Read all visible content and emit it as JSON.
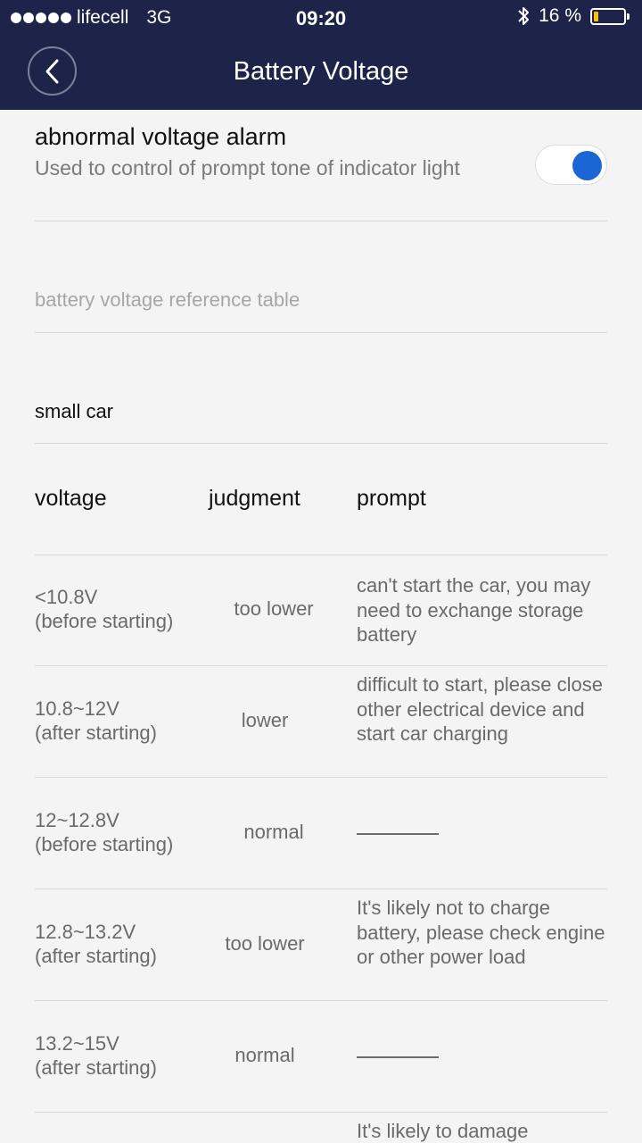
{
  "status_bar": {
    "carrier": "lifecell",
    "network": "3G",
    "time": "09:20",
    "battery": "16 %",
    "battery_level": 0.16
  },
  "nav": {
    "title": "Battery Voltage",
    "back_icon": "chevron-left-icon"
  },
  "alarm": {
    "title": "abnormal voltage alarm",
    "description": "Used to control of prompt tone of  indicator light",
    "toggle_on": true,
    "toggle_color": "#1a66d4"
  },
  "reference_title": "battery voltage reference table",
  "car_type": "small car",
  "table": {
    "headers": [
      "voltage",
      "judgment",
      "prompt"
    ],
    "rows": [
      {
        "voltage": "<10.8V",
        "condition": "(before starting)",
        "judgment": "too lower",
        "prompt": "can't start the car,  you may need to exchange storage battery"
      },
      {
        "voltage": "10.8~12V",
        "condition": "(after starting)",
        "judgment": "lower",
        "prompt": "difficult to start, please close other electrical device and start car charging"
      },
      {
        "voltage": "12~12.8V",
        "condition": "(before starting)",
        "judgment": "normal",
        "prompt": ""
      },
      {
        "voltage": "12.8~13.2V",
        "condition": "(after starting)",
        "judgment": "too lower",
        "prompt": "It's likely not to charge battery, please check engine or other power load"
      },
      {
        "voltage": "13.2~15V",
        "condition": "(after starting)",
        "judgment": "normal",
        "prompt": ""
      },
      {
        "voltage": "",
        "condition": "",
        "judgment": "",
        "prompt": "It's likely to damage"
      }
    ]
  },
  "colors": {
    "header_bg": "#1e2449",
    "page_bg": "#f4f4f4",
    "battery_fill": "#f5c400"
  }
}
